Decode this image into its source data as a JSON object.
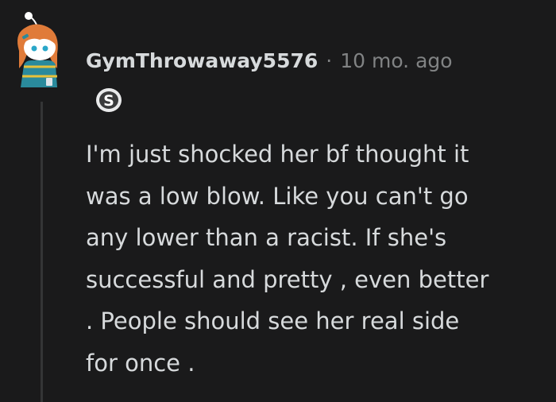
{
  "comment": {
    "username": "GymThrowaway5576",
    "separator": "·",
    "timestamp": "10 mo. ago",
    "flair_letter": "S",
    "body": "I'm just shocked her bf thought it\nwas a low blow. Like you can't go\nany lower than a racist. If she's\nsuccessful and pretty , even better\n. People should see her real side\nfor once ."
  },
  "colors": {
    "background": "#1a1a1b",
    "text": "#d7dadc",
    "meta": "#818384",
    "thread_line": "#343536",
    "avatar_hair": "#e07b39",
    "avatar_shirt": "#2a8a9c"
  },
  "icons": {
    "avatar": "snoo-avatar-icon",
    "flair": "s-badge-icon"
  }
}
